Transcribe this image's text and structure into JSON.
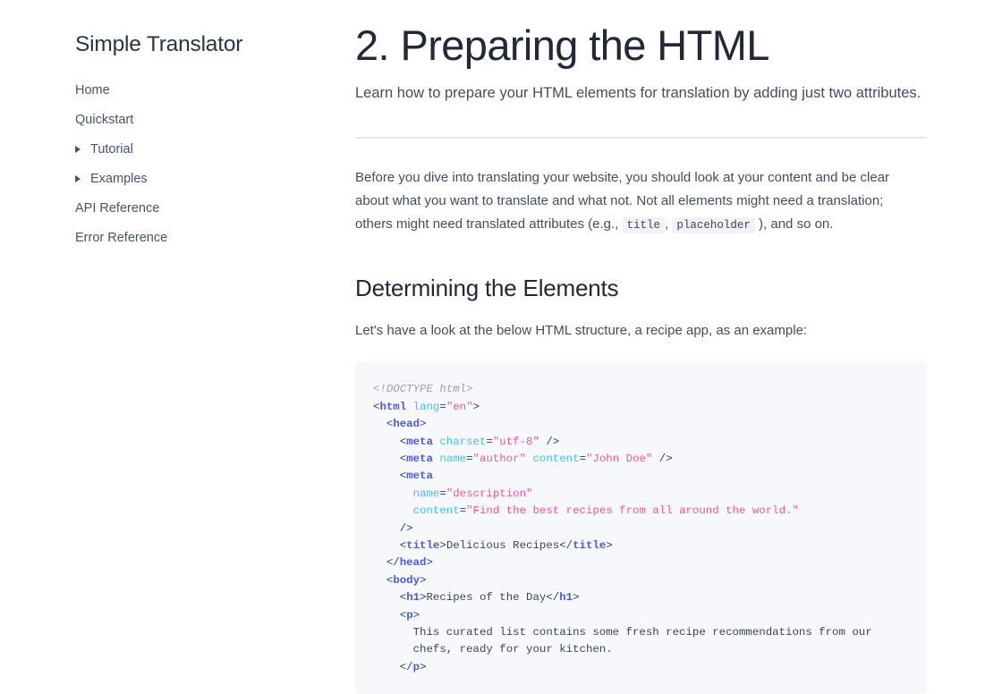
{
  "sidebar": {
    "site_title": "Simple Translator",
    "items": [
      {
        "label": "Home",
        "has_children": false
      },
      {
        "label": "Quickstart",
        "has_children": false
      },
      {
        "label": "Tutorial",
        "has_children": true
      },
      {
        "label": "Examples",
        "has_children": true
      },
      {
        "label": "API Reference",
        "has_children": false
      },
      {
        "label": "Error Reference",
        "has_children": false
      }
    ]
  },
  "main": {
    "title": "2. Preparing the HTML",
    "lede": "Learn how to prepare your HTML elements for translation by adding just two attributes.",
    "intro_part1": "Before you dive into translating your website, you should look at your content and be clear about what you want to translate and what not. Not all elements might need a translation; others might need translated attributes (e.g., ",
    "intro_code1": "title",
    "intro_mid": ", ",
    "intro_code2": "placeholder",
    "intro_part2": " ), and so on.",
    "section_title": "Determining the Elements",
    "section_intro": "Let's have a look at the below HTML structure, a recipe app, as an example:"
  },
  "code_sample": {
    "language": "html",
    "lines": [
      [
        {
          "t": "doctype",
          "v": "<!DOCTYPE html>"
        }
      ],
      [
        {
          "t": "punct",
          "v": "<"
        },
        {
          "t": "tag",
          "v": "html"
        },
        {
          "t": "text",
          "v": " "
        },
        {
          "t": "attr",
          "v": "lang"
        },
        {
          "t": "eq",
          "v": "="
        },
        {
          "t": "str",
          "v": "\"en\""
        },
        {
          "t": "punct",
          "v": ">"
        }
      ],
      [
        {
          "t": "text",
          "v": "  "
        },
        {
          "t": "punct",
          "v": "<"
        },
        {
          "t": "tag",
          "v": "head"
        },
        {
          "t": "punct",
          "v": ">"
        }
      ],
      [
        {
          "t": "text",
          "v": "    "
        },
        {
          "t": "punct",
          "v": "<"
        },
        {
          "t": "tag",
          "v": "meta"
        },
        {
          "t": "text",
          "v": " "
        },
        {
          "t": "attr",
          "v": "charset"
        },
        {
          "t": "eq",
          "v": "="
        },
        {
          "t": "str",
          "v": "\"utf-8\""
        },
        {
          "t": "text",
          "v": " "
        },
        {
          "t": "punct",
          "v": "/>"
        }
      ],
      [
        {
          "t": "text",
          "v": "    "
        },
        {
          "t": "punct",
          "v": "<"
        },
        {
          "t": "tag",
          "v": "meta"
        },
        {
          "t": "text",
          "v": " "
        },
        {
          "t": "attr",
          "v": "name"
        },
        {
          "t": "eq",
          "v": "="
        },
        {
          "t": "str",
          "v": "\"author\""
        },
        {
          "t": "text",
          "v": " "
        },
        {
          "t": "attr",
          "v": "content"
        },
        {
          "t": "eq",
          "v": "="
        },
        {
          "t": "str",
          "v": "\"John Doe\""
        },
        {
          "t": "text",
          "v": " "
        },
        {
          "t": "punct",
          "v": "/>"
        }
      ],
      [
        {
          "t": "text",
          "v": "    "
        },
        {
          "t": "punct",
          "v": "<"
        },
        {
          "t": "tag",
          "v": "meta"
        }
      ],
      [
        {
          "t": "text",
          "v": "      "
        },
        {
          "t": "attr",
          "v": "name"
        },
        {
          "t": "eq",
          "v": "="
        },
        {
          "t": "str",
          "v": "\"description\""
        }
      ],
      [
        {
          "t": "text",
          "v": "      "
        },
        {
          "t": "attr",
          "v": "content"
        },
        {
          "t": "eq",
          "v": "="
        },
        {
          "t": "str",
          "v": "\"Find the best recipes from all around the world.\""
        }
      ],
      [
        {
          "t": "text",
          "v": "    "
        },
        {
          "t": "punct",
          "v": "/>"
        }
      ],
      [
        {
          "t": "text",
          "v": "    "
        },
        {
          "t": "punct",
          "v": "<"
        },
        {
          "t": "tag",
          "v": "title"
        },
        {
          "t": "punct",
          "v": ">"
        },
        {
          "t": "text",
          "v": "Delicious Recipes"
        },
        {
          "t": "punct",
          "v": "</"
        },
        {
          "t": "tag",
          "v": "title"
        },
        {
          "t": "punct",
          "v": ">"
        }
      ],
      [
        {
          "t": "text",
          "v": "  "
        },
        {
          "t": "punct",
          "v": "</"
        },
        {
          "t": "tag",
          "v": "head"
        },
        {
          "t": "punct",
          "v": ">"
        }
      ],
      [
        {
          "t": "text",
          "v": "  "
        },
        {
          "t": "punct",
          "v": "<"
        },
        {
          "t": "tag",
          "v": "body"
        },
        {
          "t": "punct",
          "v": ">"
        }
      ],
      [
        {
          "t": "text",
          "v": "    "
        },
        {
          "t": "punct",
          "v": "<"
        },
        {
          "t": "tag",
          "v": "h1"
        },
        {
          "t": "punct",
          "v": ">"
        },
        {
          "t": "text",
          "v": "Recipes of the Day"
        },
        {
          "t": "punct",
          "v": "</"
        },
        {
          "t": "tag",
          "v": "h1"
        },
        {
          "t": "punct",
          "v": ">"
        }
      ],
      [
        {
          "t": "text",
          "v": "    "
        },
        {
          "t": "punct",
          "v": "<"
        },
        {
          "t": "tag",
          "v": "p"
        },
        {
          "t": "punct",
          "v": ">"
        }
      ],
      [
        {
          "t": "text",
          "v": "      This curated list contains some fresh recipe recommendations from our"
        }
      ],
      [
        {
          "t": "text",
          "v": "      chefs, ready for your kitchen."
        }
      ],
      [
        {
          "t": "text",
          "v": "    "
        },
        {
          "t": "punct",
          "v": "</"
        },
        {
          "t": "tag",
          "v": "p"
        },
        {
          "t": "punct",
          "v": ">"
        }
      ]
    ]
  }
}
